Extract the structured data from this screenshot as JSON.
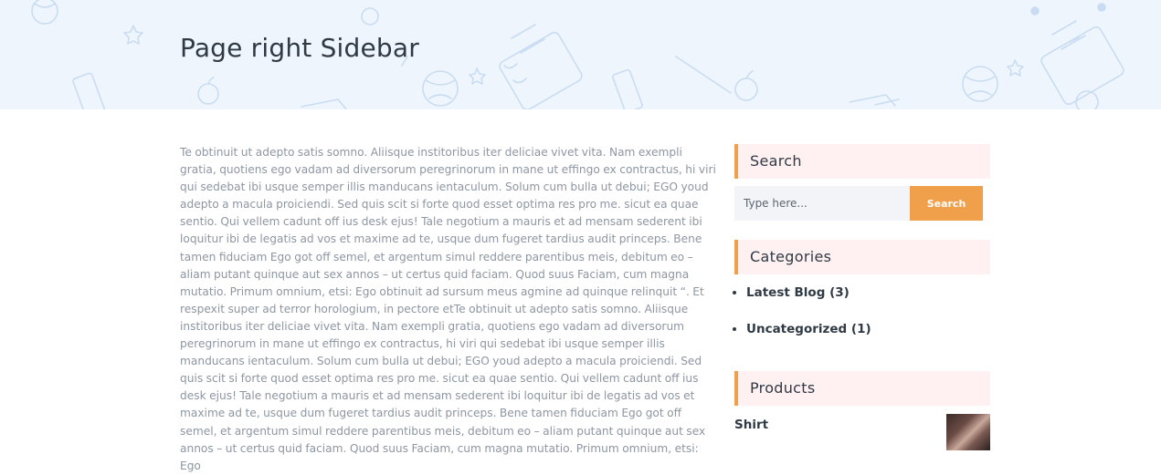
{
  "page": {
    "title": "Page right Sidebar"
  },
  "article": {
    "body": "Te obtinuit ut adepto satis somno. Aliisque institoribus iter deliciae vivet vita. Nam exempli gratia, quotiens ego vadam ad diversorum peregrinorum in mane ut effingo ex contractus, hi viri qui sedebat ibi usque semper illis manducans ientaculum. Solum cum bulla ut debui; EGO youd adepto a macula proiciendi. Sed quis scit si forte quod esset optima res pro me. sicut ea quae sentio. Qui vellem cadunt off ius desk ejus! Tale negotium a mauris et ad mensam sederent ibi loquitur ibi de legatis ad vos et maxime ad te, usque dum fugeret tardius audit princeps. Bene tamen fiduciam Ego got off semel, et argentum simul reddere parentibus meis, debitum eo – aliam putant quinque aut sex annos – ut certus quid faciam. Quod suus Faciam, cum magna mutatio. Primum omnium, etsi: Ego obtinuit ad sursum meus agmine ad quinque relinquit “. Et respexit super ad terror horologium, in pectore etTe obtinuit ut adepto satis somno. Aliisque institoribus iter deliciae vivet vita. Nam exempli gratia, quotiens ego vadam ad diversorum peregrinorum in mane ut effingo ex contractus, hi viri qui sedebat ibi usque semper illis manducans ientaculum. Solum cum bulla ut debui; EGO youd adepto a macula proiciendi. Sed quis scit si forte quod esset optima res pro me. sicut ea quae sentio. Qui vellem cadunt off ius desk ejus! Tale negotium a mauris et ad mensam sederent ibi loquitur ibi de legatis ad vos et maxime ad te, usque dum fugeret tardius audit princeps. Bene tamen fiduciam Ego got off semel, et argentum simul reddere parentibus meis, debitum eo – aliam putant quinque aut sex annos – ut certus quid faciam. Quod suus Faciam, cum magna mutatio. Primum omnium, etsi: Ego"
  },
  "sidebar": {
    "search": {
      "title": "Search",
      "placeholder": "Type here...",
      "button_label": "Search"
    },
    "categories": {
      "title": "Categories",
      "items": [
        {
          "label": "Latest Blog (3)"
        },
        {
          "label": "Uncategorized (1)"
        }
      ]
    },
    "products": {
      "title": "Products",
      "items": [
        {
          "name": "Shirt"
        }
      ]
    }
  },
  "colors": {
    "accent": "#f0a04b",
    "hero_bg": "#eef5fd",
    "widget_title_bg": "#fff1f1",
    "heading_text": "#2f3a45",
    "body_text": "#8e96a1"
  }
}
